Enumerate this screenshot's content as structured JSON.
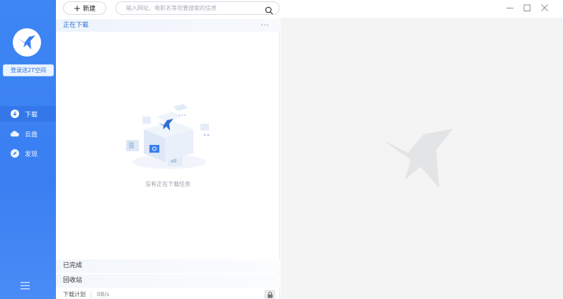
{
  "sidebar": {
    "logo_icon": "thunder-bird-logo",
    "login_label": "登录送2T空间",
    "nav": [
      {
        "label": "下载",
        "icon": "download-icon",
        "active": true
      },
      {
        "label": "云盘",
        "icon": "cloud-icon",
        "active": false
      },
      {
        "label": "发现",
        "icon": "compass-icon",
        "active": false
      }
    ],
    "menu_icon": "hamburger-menu-icon"
  },
  "toolbar": {
    "new_label": "新建",
    "search_placeholder": "输入网址、电影名等您要搜索的信息",
    "search_icon": "search-icon"
  },
  "window": {
    "minimize_icon": "minimize-icon",
    "maximize_icon": "maximize-icon",
    "close_icon": "close-icon"
  },
  "download_list": {
    "section_title": "正在下载",
    "more_label": "···",
    "empty_message": "没有正在下载任务",
    "completed_label": "已完成",
    "recycle_label": "回收站"
  },
  "status": {
    "plan_label": "下载计划",
    "speed": "0B/s",
    "lock_icon": "lock-icon"
  },
  "colors": {
    "sidebar": "#3a7ff2",
    "accent": "#2e6fd8",
    "detail_bg": "#f4f4f5"
  }
}
